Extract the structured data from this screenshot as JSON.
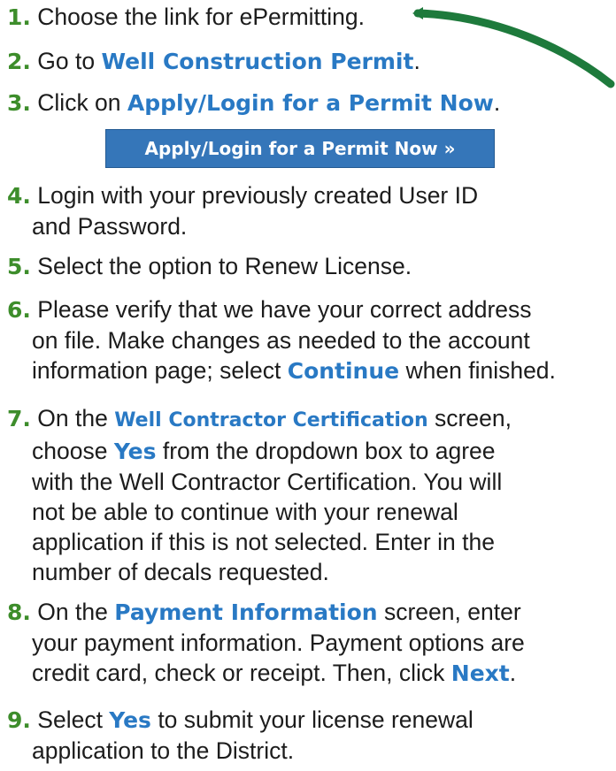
{
  "steps": {
    "s1": {
      "num": "1.",
      "text": "Choose the link for ePermitting."
    },
    "s2": {
      "num": "2.",
      "pre": "Go to ",
      "link": "Well Construction Permit",
      "post": "."
    },
    "s3": {
      "num": "3.",
      "pre": "Click on ",
      "link": "Apply/Login for a Permit Now",
      "post": "."
    },
    "s4": {
      "num": "4.",
      "line1": "Login with your previously created User ID",
      "line2": "and Password."
    },
    "s5": {
      "num": "5.",
      "text": "Select the option to Renew License."
    },
    "s6": {
      "num": "6.",
      "line1": "Please verify that we have your correct address",
      "line2": "on file. Make changes as needed to the account",
      "line3_pre": "information page; select ",
      "line3_link": "Continue",
      "line3_post": " when finished."
    },
    "s7": {
      "num": "7.",
      "line1_pre": "On the ",
      "line1_link": "Well Contractor Certification",
      "line1_post": " screen,",
      "line2_pre": "choose ",
      "line2_link": "Yes",
      "line2_post": " from the dropdown box to agree",
      "line3": "with the Well Contractor Certification. You will",
      "line4": "not be able to continue with your renewal",
      "line5": "application if this is not selected. Enter in the",
      "line6": "number of decals requested."
    },
    "s8": {
      "num": "8.",
      "line1_pre": "On the ",
      "line1_link": "Payment Information",
      "line1_post": " screen, enter",
      "line2": "your payment information. Payment options are",
      "line3_pre": "credit card, check or receipt. Then, click ",
      "line3_link": "Next",
      "line3_post": "."
    },
    "s9": {
      "num": "9.",
      "line1_pre": "Select ",
      "line1_link": "Yes",
      "line1_post": " to submit your license renewal",
      "line2": "application to the District."
    }
  },
  "button": {
    "label": "Apply/Login for a Permit Now »"
  },
  "colors": {
    "number": "#3d8d2b",
    "highlight": "#2979c4",
    "button": "#3576b9",
    "arrow": "#1e7a3c"
  }
}
